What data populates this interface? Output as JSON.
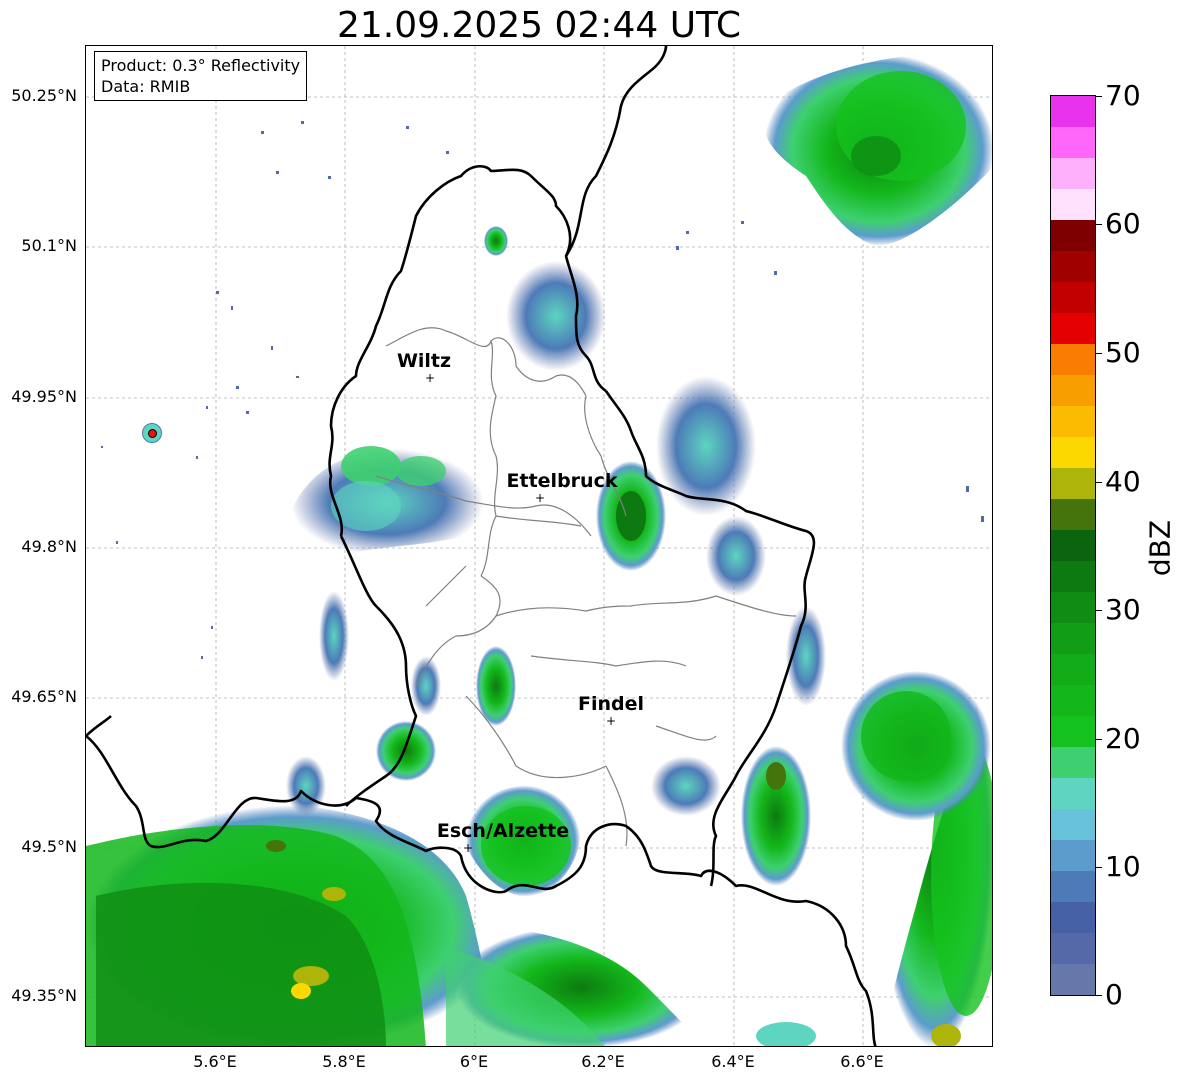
{
  "title": "21.09.2025 02:44 UTC",
  "info": {
    "product": "Product: 0.3° Reflectivity",
    "data": "Data: RMIB"
  },
  "lat_labels": [
    "50.25°N",
    "50.1°N",
    "49.95°N",
    "49.8°N",
    "49.65°N",
    "49.5°N",
    "49.35°N"
  ],
  "lon_labels": [
    "5.6°E",
    "5.8°E",
    "6°E",
    "6.2°E",
    "6.4°E",
    "6.6°E"
  ],
  "cities": [
    "Wiltz",
    "Ettelbruck",
    "Findel",
    "Esch/Alzette"
  ],
  "colorbar": {
    "unit": "dBZ",
    "ticks": [
      "0",
      "10",
      "20",
      "30",
      "40",
      "50",
      "60",
      "70"
    ],
    "colors": [
      "#6677aa",
      "#5568a8",
      "#4560a5",
      "#4d7bb8",
      "#5b9ccc",
      "#67c3db",
      "#5dd5c0",
      "#3ed070",
      "#14c21e",
      "#13b71b",
      "#12ac18",
      "#119d16",
      "#0f8c13",
      "#0c7a10",
      "#0b640e",
      "#45730c",
      "#adb40a",
      "#fcd800",
      "#fbbb00",
      "#f99e00",
      "#f97d00",
      "#e40000",
      "#c30000",
      "#a10000",
      "#7e0000",
      "#ffe1fe",
      "#ffb0fd",
      "#ff66f9",
      "#e932ec"
    ]
  },
  "radar_site_color": "#ee1111"
}
